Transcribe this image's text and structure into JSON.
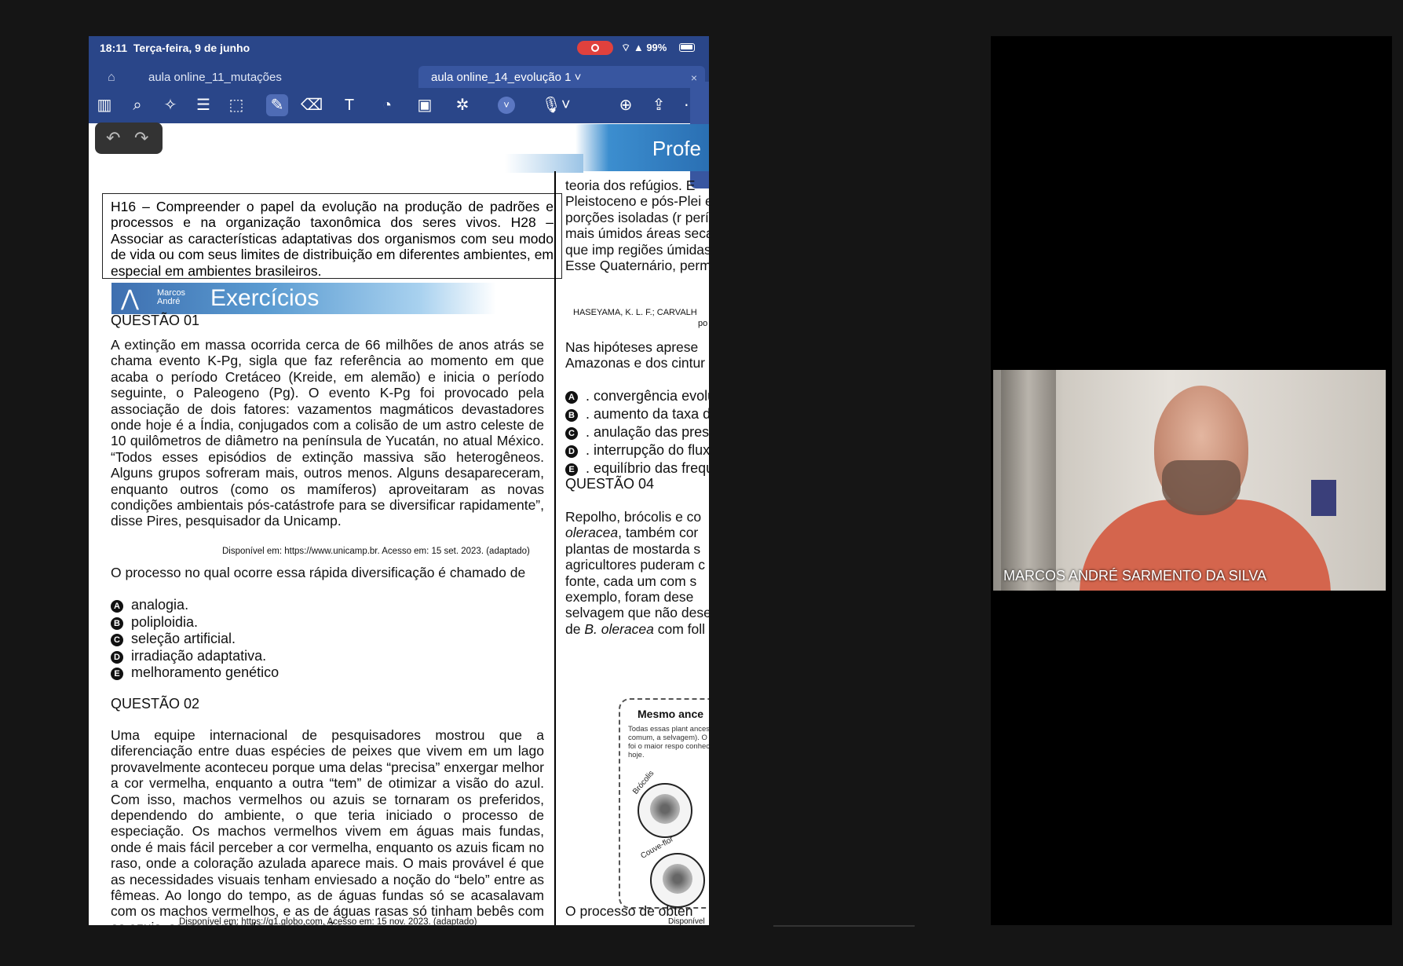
{
  "status_bar": {
    "time": "18:11",
    "date": "Terça-feira, 9 de junho",
    "battery": "99%"
  },
  "tabs": [
    {
      "label": "aula online_11_mutações"
    },
    {
      "label": "aula online_14_evolução 1 ˅"
    }
  ],
  "toolbar_icons": [
    "sidebar-icon",
    "search-icon",
    "magic-icon",
    "document-icon",
    "lasso-icon",
    "pen-icon",
    "eraser-icon",
    "text-icon",
    "shape-icon",
    "image-icon",
    "elements-icon",
    "more-icon",
    "mic-icon",
    "add-page-icon",
    "share-icon",
    "more-options-icon"
  ],
  "document": {
    "header_right": "Profe",
    "skills": "H16 – Compreender o papel da evolução na produção de padrões e processos e na organização taxonômica dos seres vivos. H28 – Associar as características adaptativas dos organismos com seu modo de vida ou com seus limites de distribuição em diferentes ambientes, em especial em ambientes brasileiros.",
    "exercises_title": "Exercícios",
    "brand": "Marcos André",
    "q1_title": "QUESTÃO 01",
    "q1_text": "A extinção em massa ocorrida cerca de 66 milhões de anos atrás se chama evento K-Pg, sigla que faz referência ao momento em que acaba o período Cretáceo (Kreide, em alemão) e inicia o período seguinte, o Paleogeno (Pg). O evento K-Pg foi provocado pela associação de dois fatores: vazamentos magmáticos devastadores onde hoje é a Índia, conjugados com a colisão de um astro celeste de 10 quilômetros de diâmetro na península de Yucatán, no atual México. “Todos esses episódios de extinção massiva são heterogêneos. Alguns grupos sofreram mais, outros menos. Alguns desapareceram, enquanto outros (como os mamíferos) aproveitaram as novas condições ambientais pós-catástrofe para se diversificar rapidamente”, disse Pires, pesquisador da Unicamp.",
    "q1_source": "Disponível em: https://www.unicamp.br. Acesso em: 15 set. 2023. (adaptado)",
    "q1_prompt": "O processo no qual ocorre essa rápida diversificação é chamado de",
    "q1_options": [
      {
        "letter": "A",
        "text": "analogia."
      },
      {
        "letter": "B",
        "text": "poliploidia."
      },
      {
        "letter": "C",
        "text": "seleção artificial."
      },
      {
        "letter": "D",
        "text": "irradiação adaptativa."
      },
      {
        "letter": "E",
        "text": "melhoramento genético"
      }
    ],
    "q2_title": "QUESTÃO 02",
    "q2_text": "Uma equipe internacional de pesquisadores mostrou que a diferenciação entre duas espécies de peixes que vivem em um lago provavelmente aconteceu porque uma delas “precisa” enxergar melhor a cor vermelha, enquanto a outra “tem” de otimizar a visão do azul. Com isso, machos vermelhos ou azuis se tornaram os preferidos, dependendo do ambiente, o que teria iniciado o processo de especiação. Os machos vermelhos vivem em águas mais fundas, onde é mais fácil perceber a cor vermelha, enquanto os azuis ficam no raso, onde a coloração azulada aparece mais. O mais provável é que as necessidades visuais tenham enviesado a noção do “belo” entre as fêmeas. Ao longo do tempo, as de águas fundas só se acasalavam com os machos vermelhos, e as de águas rasas só tinham bebês com os azuis, sacramentando a separação.",
    "q2_source": "Disponível em: https://g1.globo.com. Acesso em: 15 nov. 2023. (adaptado)",
    "right_top_text": "teoria dos refúgios. E Pleistoceno e pós-Plei em porções isoladas (r períodos mais úmidos áreas secas que imp regiões úmidas. Esse Quaternário, permitind",
    "right_source": "HASEYAMA, K. L. F.; CARVALH",
    "right_source2": "po",
    "right_q3_prompt": "Nas hipóteses aprese Amazonas e dos cintur",
    "q3_options": [
      {
        "letter": "A",
        "text": ". convergência evolu"
      },
      {
        "letter": "B",
        "text": ". aumento da taxa d"
      },
      {
        "letter": "C",
        "text": ". anulação das pres"
      },
      {
        "letter": "D",
        "text": ". interrupção do flux"
      },
      {
        "letter": "E",
        "text": ". equilíbrio das frequ"
      }
    ],
    "q4_title": "QUESTÃO 04",
    "q4_text_1": "Repolho, brócolis e co",
    "q4_text_2": "oleracea",
    "q4_text_3": ", também cor plantas de mostarda s agricultores puderam c fonte, cada um com s exemplo, foram dese selvagem que não dese de ",
    "q4_text_4": "B. oleracea",
    "q4_text_5": " com foll",
    "diagram_title": "Mesmo ance",
    "diagram_desc": "Todas essas plant ancestral comum, a selvagem). O proce foi o maior respo conhecemos hoje.",
    "diagram_label_1": "Brócolis",
    "diagram_label_2": "Couve-flor",
    "diagram_source": "Disponível e",
    "bottom_text": "O processo de obten"
  },
  "video": {
    "participant_name": "MARCOS ANDRÉ SARMENTO DA SILVA"
  }
}
